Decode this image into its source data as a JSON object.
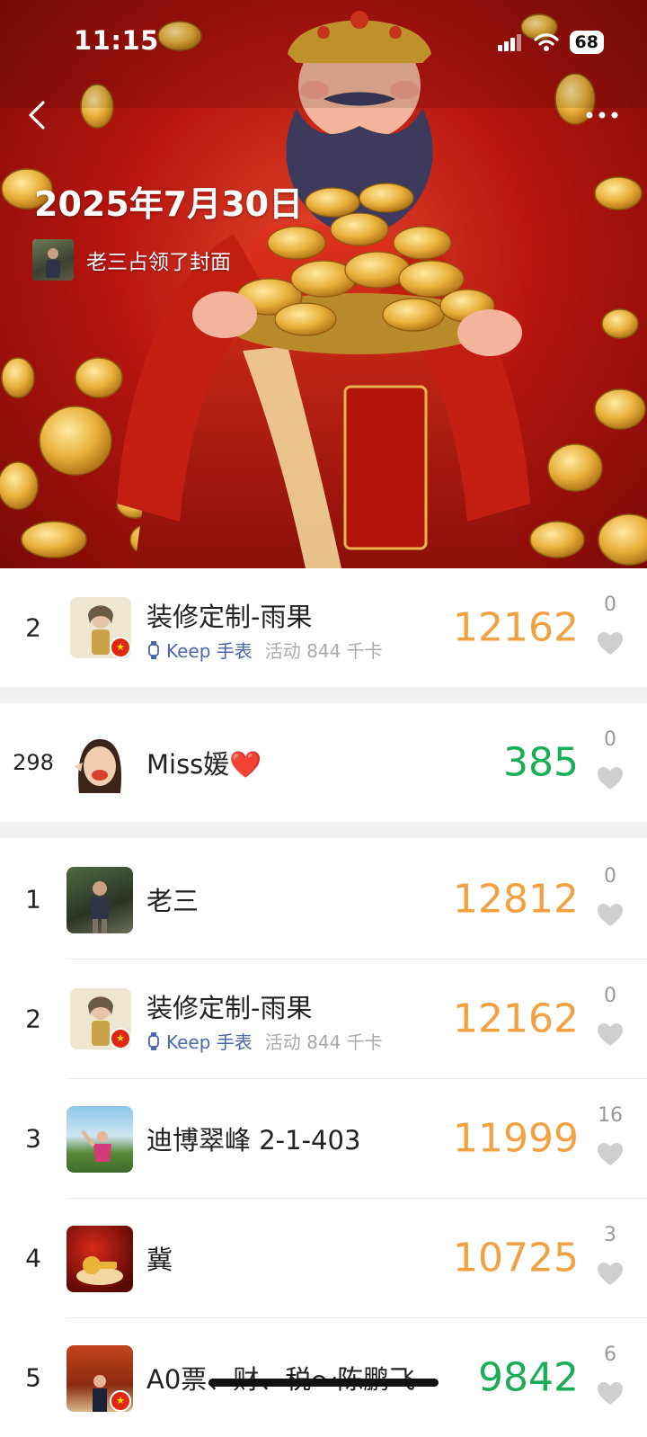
{
  "status": {
    "time": "11:15",
    "battery": "68"
  },
  "header": {
    "title": "2025年7月30日",
    "cover_text": "老三占领了封面"
  },
  "rows": [
    {
      "rank": "2",
      "name": "装修定制-雨果",
      "device": "Keep 手表",
      "meta": "活动 844 千卡",
      "score": "12162",
      "likes": "0",
      "score_color": "#f1a042"
    },
    {
      "rank": "298",
      "name": "Miss媛❤️",
      "score": "385",
      "likes": "0",
      "score_color": "#19ae55"
    },
    {
      "rank": "1",
      "name": "老三",
      "score": "12812",
      "likes": "0",
      "score_color": "#f1a042"
    },
    {
      "rank": "2",
      "name": "装修定制-雨果",
      "device": "Keep 手表",
      "meta": "活动 844 千卡",
      "score": "12162",
      "likes": "0",
      "score_color": "#f1a042"
    },
    {
      "rank": "3",
      "name": "迪博翠峰 2-1-403",
      "score": "11999",
      "likes": "16",
      "score_color": "#f1a042"
    },
    {
      "rank": "4",
      "name": "冀",
      "score": "10725",
      "likes": "3",
      "score_color": "#f1a042"
    },
    {
      "rank": "5",
      "name": "A0票、财、税～陈鹏飞",
      "score": "9842",
      "likes": "6",
      "score_color": "#19ae55"
    }
  ],
  "icons": {
    "back": "chevron-left-icon",
    "more": "more-dots-icon",
    "heart": "heart-icon",
    "watch": "watch-icon"
  }
}
